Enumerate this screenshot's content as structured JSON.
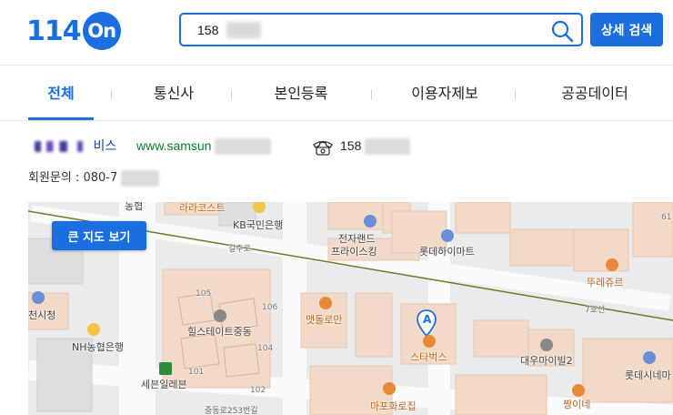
{
  "header": {
    "logo_number": "114",
    "logo_on": "On",
    "search_value": "158",
    "detail_search_label": "상세 검색"
  },
  "tabs": [
    {
      "label": "전체",
      "active": true
    },
    {
      "label": "통신사",
      "active": false
    },
    {
      "label": "본인등록",
      "active": false
    },
    {
      "label": "이용자제보",
      "active": false
    },
    {
      "label": "공공데이터",
      "active": false
    }
  ],
  "result": {
    "name_suffix": "비스",
    "url": "www.samsun",
    "phone": "158",
    "contact_label": "회원문의 : 080-7"
  },
  "map": {
    "big_map_button": "큰 지도 보기",
    "labels": {
      "laracoste": "라라코스트",
      "kb_bank": "KB국민은행",
      "electro_land": "전자랜드",
      "price_king": "프라이스킹",
      "lotte_himart": "롯데하이마트",
      "tous_les_jours": "뚜레쥬르",
      "line7": "7호선",
      "city_hall": "천시청",
      "nh_bank": "NH농협은행",
      "hills_state": "힐스테이트중동",
      "seven_eleven": "세븐일레븐",
      "pizza": "맷돌로만",
      "starbucks": "스타벅스",
      "daewoo_mall": "대우마이빌2",
      "lotte_cinema": "롯데시네마",
      "mapo_ro": "마포화로집",
      "jjang": "짱이네",
      "road1": "길주로",
      "road2": "중동로253번길",
      "bldg105": "105",
      "bldg106": "106",
      "bldg104": "104",
      "bldg101": "101",
      "bldg102": "102",
      "bldg61": "61",
      "marker_letter": "A",
      "top_fragment": "농협"
    }
  },
  "colors": {
    "brand": "#1a6ee0",
    "url_green": "#117a2a",
    "name_blue": "#1a3fb0",
    "building": "#f3d9c7",
    "road_line": "#6b7a2a"
  }
}
